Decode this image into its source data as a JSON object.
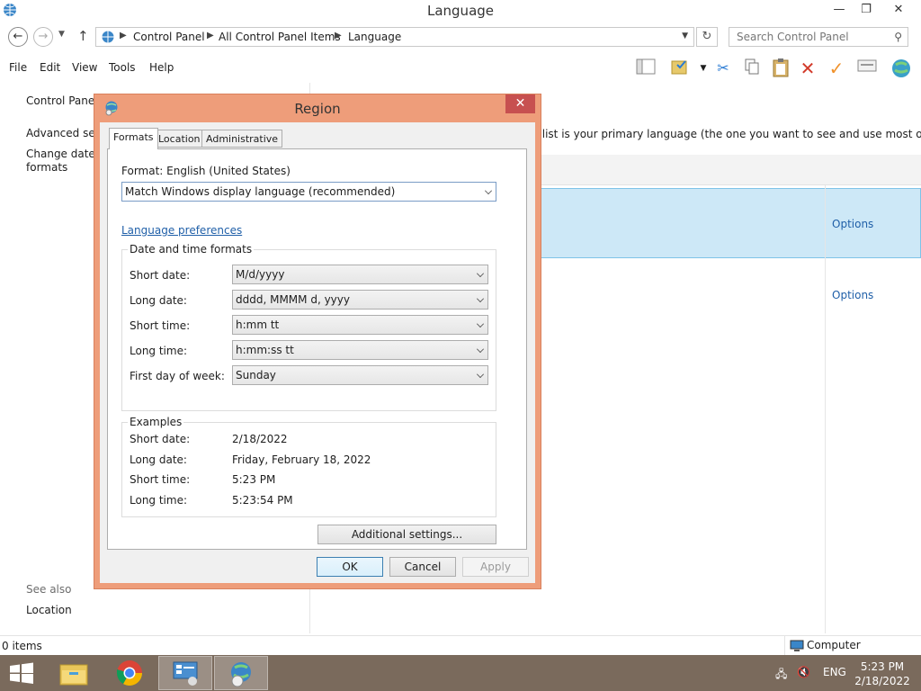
{
  "window": {
    "title": "Language",
    "minimize": "—",
    "maximize": "❐",
    "close": "✕"
  },
  "address": {
    "crumbs": [
      "Control Panel",
      "All Control Panel Items",
      "Language"
    ],
    "search_placeholder": "Search Control Panel"
  },
  "menu": [
    "File",
    "Edit",
    "View",
    "Tools",
    "Help"
  ],
  "left_pane": {
    "home": "Control Panel",
    "advanced": "Advanced sett",
    "change_date_1": "Change date, t",
    "change_date_2": "formats",
    "see_also": "See also",
    "location": "Location"
  },
  "right_pane": {
    "description": "r list is your primary language (the one you want to see and use most often).",
    "options_1": "Options",
    "options_2": "Options"
  },
  "status": {
    "items": "0 items",
    "computer": "Computer"
  },
  "taskbar": {
    "lang": "ENG",
    "time": "5:23 PM",
    "date": "2/18/2022"
  },
  "dialog": {
    "title": "Region",
    "close": "✕",
    "tabs": [
      "Formats",
      "Location",
      "Administrative"
    ],
    "format_label": "Format: English (United States)",
    "format_value": "Match Windows display language (recommended)",
    "language_prefs": "Language preferences",
    "dt_group": "Date and time formats",
    "fields": [
      {
        "label": "Short date:",
        "value": "M/d/yyyy"
      },
      {
        "label": "Long date:",
        "value": "dddd, MMMM d, yyyy"
      },
      {
        "label": "Short time:",
        "value": "h:mm tt"
      },
      {
        "label": "Long time:",
        "value": "h:mm:ss tt"
      },
      {
        "label": "First day of week:",
        "value": "Sunday"
      }
    ],
    "examples_group": "Examples",
    "examples": [
      {
        "label": "Short date:",
        "value": "2/18/2022"
      },
      {
        "label": "Long date:",
        "value": "Friday, February 18, 2022"
      },
      {
        "label": "Short time:",
        "value": "5:23 PM"
      },
      {
        "label": "Long time:",
        "value": "5:23:54 PM"
      }
    ],
    "additional": "Additional settings...",
    "ok": "OK",
    "cancel": "Cancel",
    "apply": "Apply"
  }
}
